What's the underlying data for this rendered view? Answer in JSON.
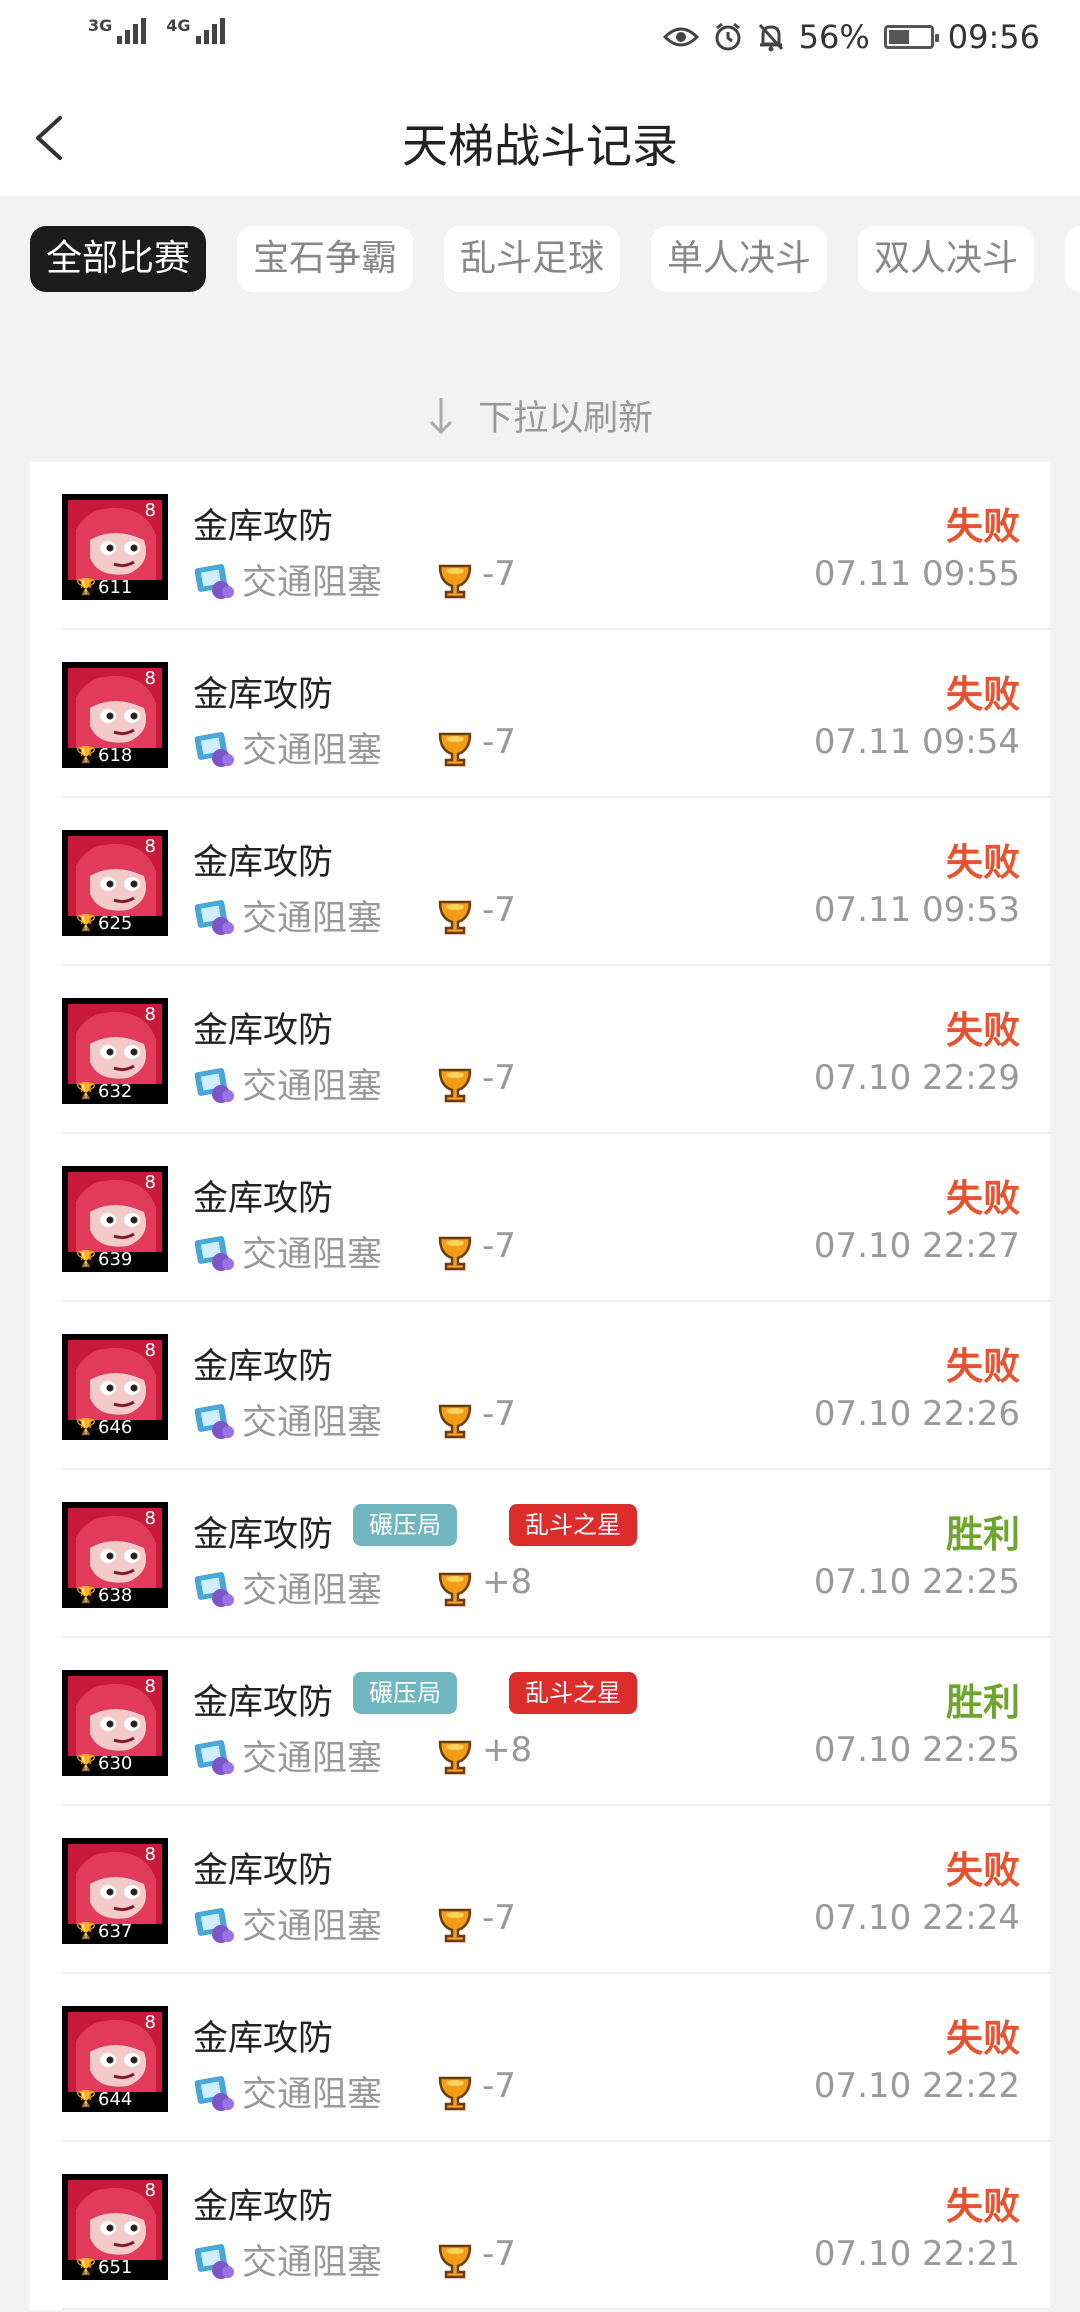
{
  "status_bar": {
    "net1": "3G",
    "net2": "4G",
    "battery": "56%",
    "battery_level": 0.56,
    "time": "09:56",
    "icons": [
      "eye-icon",
      "alarm-icon",
      "mute-bell-icon",
      "battery-icon"
    ]
  },
  "header": {
    "title": "天梯战斗记录",
    "back_icon": "chevron-left-icon"
  },
  "filters": [
    {
      "label": "全部比赛",
      "active": true
    },
    {
      "label": "宝石争霸",
      "active": false
    },
    {
      "label": "乱斗足球",
      "active": false
    },
    {
      "label": "单人决斗",
      "active": false
    },
    {
      "label": "双人决斗",
      "active": false
    }
  ],
  "pull_hint": "下拉以刷新",
  "colors": {
    "lose": "#e8532f",
    "win": "#6fa52e",
    "tag_crush": "#6fb6bf",
    "tag_star": "#dc2c2c"
  },
  "records": [
    {
      "mode": "金库攻防",
      "map": "交通阻塞",
      "change": "-7",
      "result": "失败",
      "outcome": "lose",
      "time": "07.11 09:55",
      "trophies": "611",
      "power": "8",
      "tags": []
    },
    {
      "mode": "金库攻防",
      "map": "交通阻塞",
      "change": "-7",
      "result": "失败",
      "outcome": "lose",
      "time": "07.11 09:54",
      "trophies": "618",
      "power": "8",
      "tags": []
    },
    {
      "mode": "金库攻防",
      "map": "交通阻塞",
      "change": "-7",
      "result": "失败",
      "outcome": "lose",
      "time": "07.11 09:53",
      "trophies": "625",
      "power": "8",
      "tags": []
    },
    {
      "mode": "金库攻防",
      "map": "交通阻塞",
      "change": "-7",
      "result": "失败",
      "outcome": "lose",
      "time": "07.10 22:29",
      "trophies": "632",
      "power": "8",
      "tags": []
    },
    {
      "mode": "金库攻防",
      "map": "交通阻塞",
      "change": "-7",
      "result": "失败",
      "outcome": "lose",
      "time": "07.10 22:27",
      "trophies": "639",
      "power": "8",
      "tags": []
    },
    {
      "mode": "金库攻防",
      "map": "交通阻塞",
      "change": "-7",
      "result": "失败",
      "outcome": "lose",
      "time": "07.10 22:26",
      "trophies": "646",
      "power": "8",
      "tags": []
    },
    {
      "mode": "金库攻防",
      "map": "交通阻塞",
      "change": "+8",
      "result": "胜利",
      "outcome": "win",
      "time": "07.10 22:25",
      "trophies": "638",
      "power": "8",
      "tags": [
        "碾压局",
        "乱斗之星"
      ]
    },
    {
      "mode": "金库攻防",
      "map": "交通阻塞",
      "change": "+8",
      "result": "胜利",
      "outcome": "win",
      "time": "07.10 22:25",
      "trophies": "630",
      "power": "8",
      "tags": [
        "碾压局",
        "乱斗之星"
      ]
    },
    {
      "mode": "金库攻防",
      "map": "交通阻塞",
      "change": "-7",
      "result": "失败",
      "outcome": "lose",
      "time": "07.10 22:24",
      "trophies": "637",
      "power": "8",
      "tags": []
    },
    {
      "mode": "金库攻防",
      "map": "交通阻塞",
      "change": "-7",
      "result": "失败",
      "outcome": "lose",
      "time": "07.10 22:22",
      "trophies": "644",
      "power": "8",
      "tags": []
    },
    {
      "mode": "金库攻防",
      "map": "交通阻塞",
      "change": "-7",
      "result": "失败",
      "outcome": "lose",
      "time": "07.10 22:21",
      "trophies": "651",
      "power": "8",
      "tags": []
    }
  ]
}
